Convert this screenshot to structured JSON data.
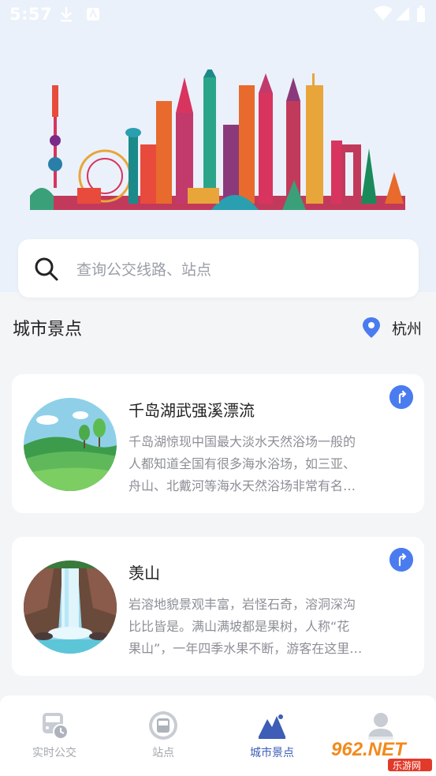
{
  "status_bar": {
    "time": "5:57"
  },
  "search": {
    "placeholder": "查询公交线路、站点"
  },
  "section": {
    "title": "城市景点",
    "city": "杭州"
  },
  "attractions": [
    {
      "title": "千岛湖武强溪漂流",
      "desc_lines": [
        "千岛湖惊现中国最大淡水天然浴场一般的",
        "人都知道全国有很多海水浴场，如三亚、",
        "舟山、北戴河等海水天然浴场非常有名…"
      ]
    },
    {
      "title": "羡山",
      "desc_lines": [
        "岩溶地貌景观丰富，岩怪石奇，溶洞深沟",
        "比比皆是。满山满坡都是果树，人称“花",
        "果山”，一年四季水果不断，游客在这里…"
      ]
    }
  ],
  "tabs": [
    {
      "label": "实时公交",
      "icon": "bus-clock-icon",
      "active": false
    },
    {
      "label": "站点",
      "icon": "bus-stop-icon",
      "active": false
    },
    {
      "label": "城市景点",
      "icon": "mountain-icon",
      "active": true
    },
    {
      "label": "",
      "icon": "user-icon",
      "active": false
    }
  ],
  "watermark": {
    "main": "962.NET",
    "sub": "乐游网"
  },
  "colors": {
    "accent": "#4a7cf0",
    "tab_active": "#3d5db6",
    "hero_bg": "#eaf1fa"
  }
}
